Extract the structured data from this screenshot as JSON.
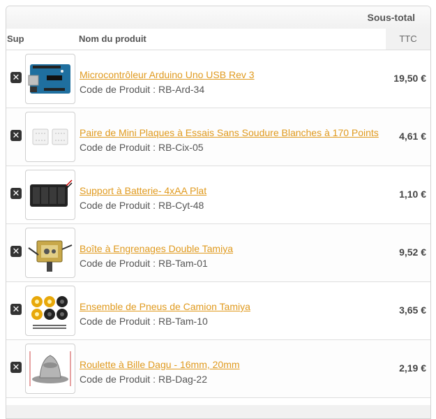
{
  "header": {
    "subtotal_label": "Sous-total",
    "col_delete": "Sup",
    "col_product": "Nom du produit",
    "col_tax": "TTC"
  },
  "code_label": "Code de Produit :",
  "items": [
    {
      "name": "Microcontrôleur Arduino Uno USB Rev 3",
      "code": "RB-Ard-34",
      "price": "19,50 €",
      "image": "arduino-board-icon"
    },
    {
      "name": "Paire de Mini Plaques à Essais Sans Soudure Blanches à 170 Points",
      "code": "RB-Cix-05",
      "price": "4,61 €",
      "image": "breadboard-icon"
    },
    {
      "name": "Support à Batterie- 4xAA Plat",
      "code": "RB-Cyt-48",
      "price": "1,10 €",
      "image": "battery-holder-icon"
    },
    {
      "name": "Boîte à Engrenages Double Tamiya",
      "code": "RB-Tam-01",
      "price": "9,52 €",
      "image": "gearbox-icon"
    },
    {
      "name": "Ensemble de Pneus de Camion Tamiya",
      "code": "RB-Tam-10",
      "price": "3,65 €",
      "image": "tires-icon"
    },
    {
      "name": "Roulette à Bille Dagu - 16mm, 20mm",
      "code": "RB-Dag-22",
      "price": "2,19 €",
      "image": "ball-caster-icon"
    }
  ],
  "colors": {
    "link": "#e09a1e",
    "header_bg": "#f1f1f1",
    "border": "#d4d4d4"
  }
}
